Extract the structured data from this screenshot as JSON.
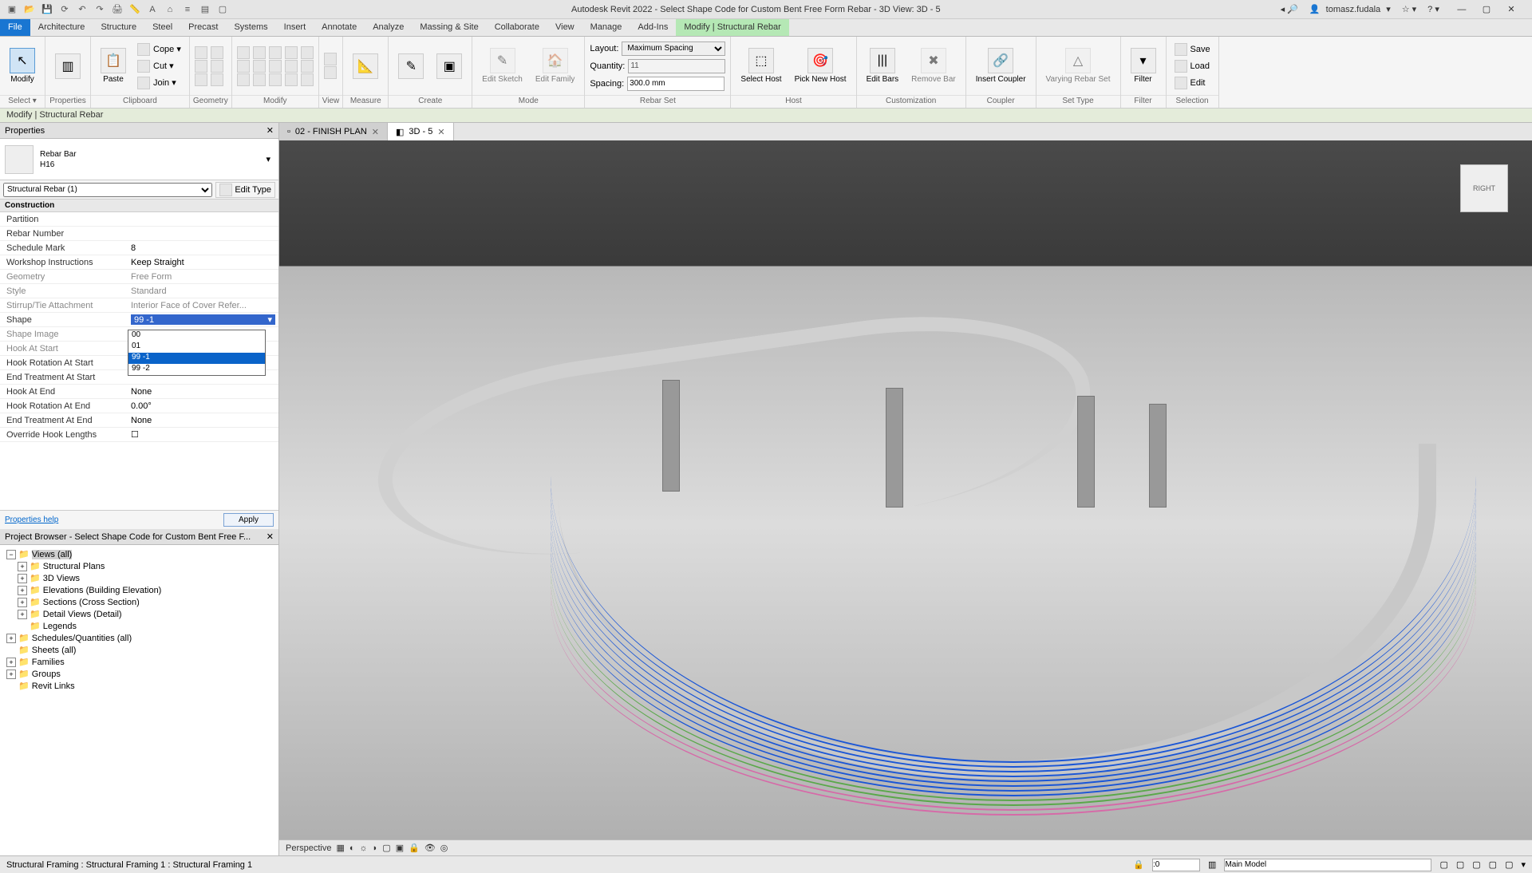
{
  "title": "Autodesk Revit 2022 - Select Shape Code for Custom Bent Free Form Rebar - 3D View: 3D - 5",
  "user": "tomasz.fudala",
  "menu": [
    "File",
    "Architecture",
    "Structure",
    "Steel",
    "Precast",
    "Systems",
    "Insert",
    "Annotate",
    "Analyze",
    "Massing & Site",
    "Collaborate",
    "View",
    "Manage",
    "Add-Ins",
    "Modify | Structural Rebar"
  ],
  "ribbon": {
    "select": {
      "label": "Select ▾",
      "btn": "Modify"
    },
    "properties": "Properties",
    "clipboard": {
      "label": "Clipboard",
      "paste": "Paste",
      "cope": "Cope ▾",
      "cut": "Cut ▾",
      "join": "Join ▾"
    },
    "geometry": "Geometry",
    "modify": "Modify",
    "view": "View",
    "measure": "Measure",
    "create": "Create",
    "mode": {
      "label": "Mode",
      "sketch": "Edit Sketch",
      "family": "Edit Family"
    },
    "rebarset": {
      "label": "Rebar Set",
      "layout": {
        "name": "Layout:",
        "value": "Maximum Spacing"
      },
      "quantity": {
        "name": "Quantity:",
        "value": "11"
      },
      "spacing": {
        "name": "Spacing:",
        "value": "300.0 mm"
      }
    },
    "host": {
      "label": "Host",
      "select": "Select Host",
      "pick": "Pick New Host"
    },
    "customization": {
      "label": "Customization",
      "edit": "Edit Bars",
      "remove": "Remove Bar"
    },
    "coupler": {
      "label": "Coupler",
      "insert": "Insert Coupler"
    },
    "settype": {
      "label": "Set Type",
      "varying": "Varying Rebar Set"
    },
    "filter": {
      "label": "Filter",
      "btn": "Filter"
    },
    "selection": {
      "label": "Selection",
      "save": "Save",
      "load": "Load",
      "edit": "Edit"
    }
  },
  "option_bar": "Modify | Structural Rebar",
  "props_panel": {
    "title": "Properties",
    "type_name": "Rebar Bar",
    "type_sub": "H16",
    "filter": "Structural Rebar (1)",
    "edit_type": "Edit Type",
    "group": "Construction",
    "rows": [
      {
        "n": "Partition",
        "v": ""
      },
      {
        "n": "Rebar Number",
        "v": ""
      },
      {
        "n": "Schedule Mark",
        "v": "8"
      },
      {
        "n": "Workshop Instructions",
        "v": "Keep Straight"
      },
      {
        "n": "Geometry",
        "v": "Free Form",
        "g": true
      },
      {
        "n": "Style",
        "v": "Standard",
        "g": true
      },
      {
        "n": "Stirrup/Tie Attachment",
        "v": "Interior Face of Cover Refer...",
        "g": true
      },
      {
        "n": "Shape",
        "v": "99 -1",
        "dd": true
      },
      {
        "n": "Shape Image",
        "v": "",
        "g": true
      },
      {
        "n": "Hook At Start",
        "v": "",
        "g": true
      },
      {
        "n": "Hook Rotation At Start",
        "v": ""
      },
      {
        "n": "End Treatment At Start",
        "v": ""
      },
      {
        "n": "Hook At End",
        "v": "None"
      },
      {
        "n": "Hook Rotation At End",
        "v": "0.00°"
      },
      {
        "n": "End Treatment At End",
        "v": "None"
      },
      {
        "n": "Override Hook Lengths",
        "v": "☐"
      }
    ],
    "dd_items": [
      "00",
      "01",
      "99 -1",
      "99 -2"
    ],
    "help": "Properties help",
    "apply": "Apply"
  },
  "browser": {
    "title": "Project Browser - Select Shape Code for Custom Bent Free F...",
    "tree": [
      {
        "l": 0,
        "t": "Views (all)",
        "sel": true,
        "exp": "−"
      },
      {
        "l": 1,
        "t": "Structural Plans",
        "exp": "+"
      },
      {
        "l": 1,
        "t": "3D Views",
        "exp": "+"
      },
      {
        "l": 1,
        "t": "Elevations (Building Elevation)",
        "exp": "+"
      },
      {
        "l": 1,
        "t": "Sections (Cross Section)",
        "exp": "+"
      },
      {
        "l": 1,
        "t": "Detail Views (Detail)",
        "exp": "+"
      },
      {
        "l": 1,
        "t": "Legends"
      },
      {
        "l": 0,
        "t": "Schedules/Quantities (all)",
        "exp": "+"
      },
      {
        "l": 0,
        "t": "Sheets (all)"
      },
      {
        "l": 0,
        "t": "Families",
        "exp": "+"
      },
      {
        "l": 0,
        "t": "Groups",
        "exp": "+"
      },
      {
        "l": 0,
        "t": "Revit Links"
      }
    ]
  },
  "tabs": [
    {
      "label": "02 - FINISH PLAN",
      "active": false
    },
    {
      "label": "3D - 5",
      "active": true
    }
  ],
  "viewbar_label": "Perspective",
  "nav_cube": "RIGHT",
  "status": {
    "msg": "Structural Framing : Structural Framing 1 : Structural Framing 1",
    "workset": "Main Model",
    "scale": ":0"
  },
  "rebar_colors": {
    "blue": "#1a56d6",
    "green": "#5aa84a",
    "pink": "#d66aa8"
  }
}
